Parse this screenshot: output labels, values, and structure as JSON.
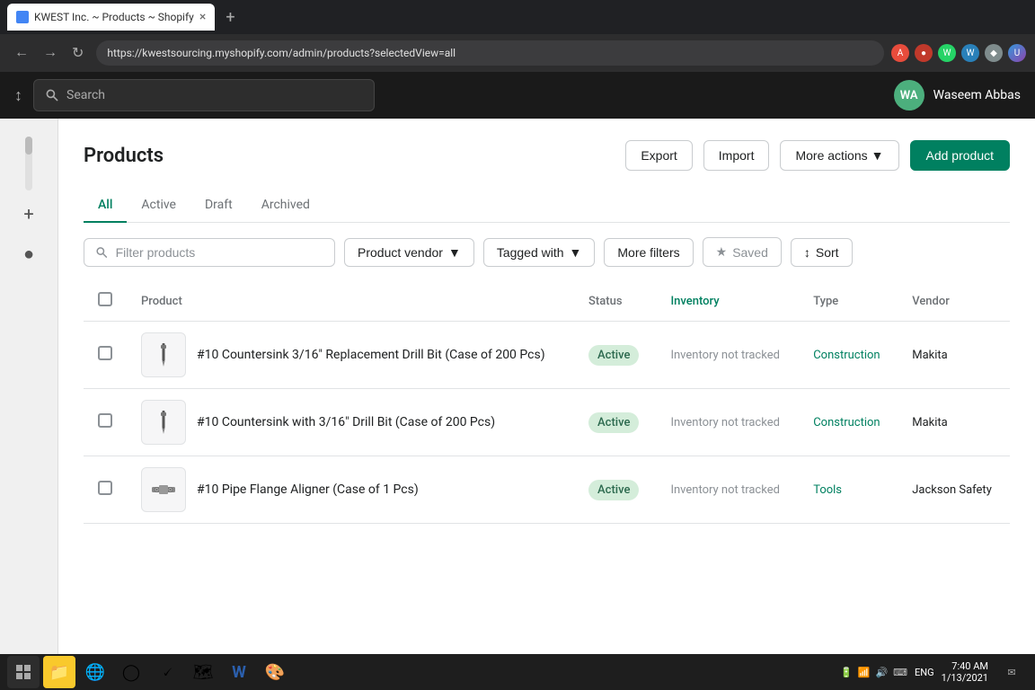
{
  "browser": {
    "tab_title": "KWEST Inc. ~ Products ~ Shopify",
    "favicon_color": "#4285f4",
    "address": "https://kwestsourcing.myshopify.com/admin/products?selectedView=all",
    "new_tab_label": "+",
    "close_tab_label": "×",
    "search_placeholder": "Search"
  },
  "nav": {
    "user_initials": "WA",
    "user_name": "Waseem Abbas",
    "search_placeholder": "Search",
    "avatar_bg": "#4caf7d"
  },
  "page": {
    "title": "Products",
    "export_label": "Export",
    "import_label": "Import",
    "more_actions_label": "More actions",
    "add_product_label": "Add product"
  },
  "tabs": [
    {
      "label": "All",
      "active": true
    },
    {
      "label": "Active",
      "active": false
    },
    {
      "label": "Draft",
      "active": false
    },
    {
      "label": "Archived",
      "active": false
    }
  ],
  "filters": {
    "search_placeholder": "Filter products",
    "product_vendor_label": "Product vendor",
    "tagged_with_label": "Tagged with",
    "more_filters_label": "More filters",
    "saved_label": "Saved",
    "sort_label": "Sort"
  },
  "table": {
    "columns": [
      {
        "key": "product",
        "label": "Product",
        "highlight": false
      },
      {
        "key": "status",
        "label": "Status",
        "highlight": false
      },
      {
        "key": "inventory",
        "label": "Inventory",
        "highlight": true
      },
      {
        "key": "type",
        "label": "Type",
        "highlight": false
      },
      {
        "key": "vendor",
        "label": "Vendor",
        "highlight": false
      }
    ],
    "rows": [
      {
        "id": 1,
        "name": "#10 Countersink 3/16\" Replacement Drill Bit (Case of 200 Pcs)",
        "status": "Active",
        "inventory": "Inventory not tracked",
        "type": "Construction",
        "vendor": "Makita",
        "thumb_shape": "drill_bit"
      },
      {
        "id": 2,
        "name": "#10 Countersink with 3/16\" Drill Bit (Case of 200 Pcs)",
        "status": "Active",
        "inventory": "Inventory not tracked",
        "type": "Construction",
        "vendor": "Makita",
        "thumb_shape": "drill_bit"
      },
      {
        "id": 3,
        "name": "#10 Pipe Flange Aligner (Case of 1 Pcs)",
        "status": "Active",
        "inventory": "Inventory not tracked",
        "type": "Tools",
        "vendor": "Jackson Safety",
        "thumb_shape": "flange"
      }
    ]
  },
  "taskbar": {
    "time": "7:40 AM",
    "date": "1/13/2021",
    "language": "ENG"
  }
}
